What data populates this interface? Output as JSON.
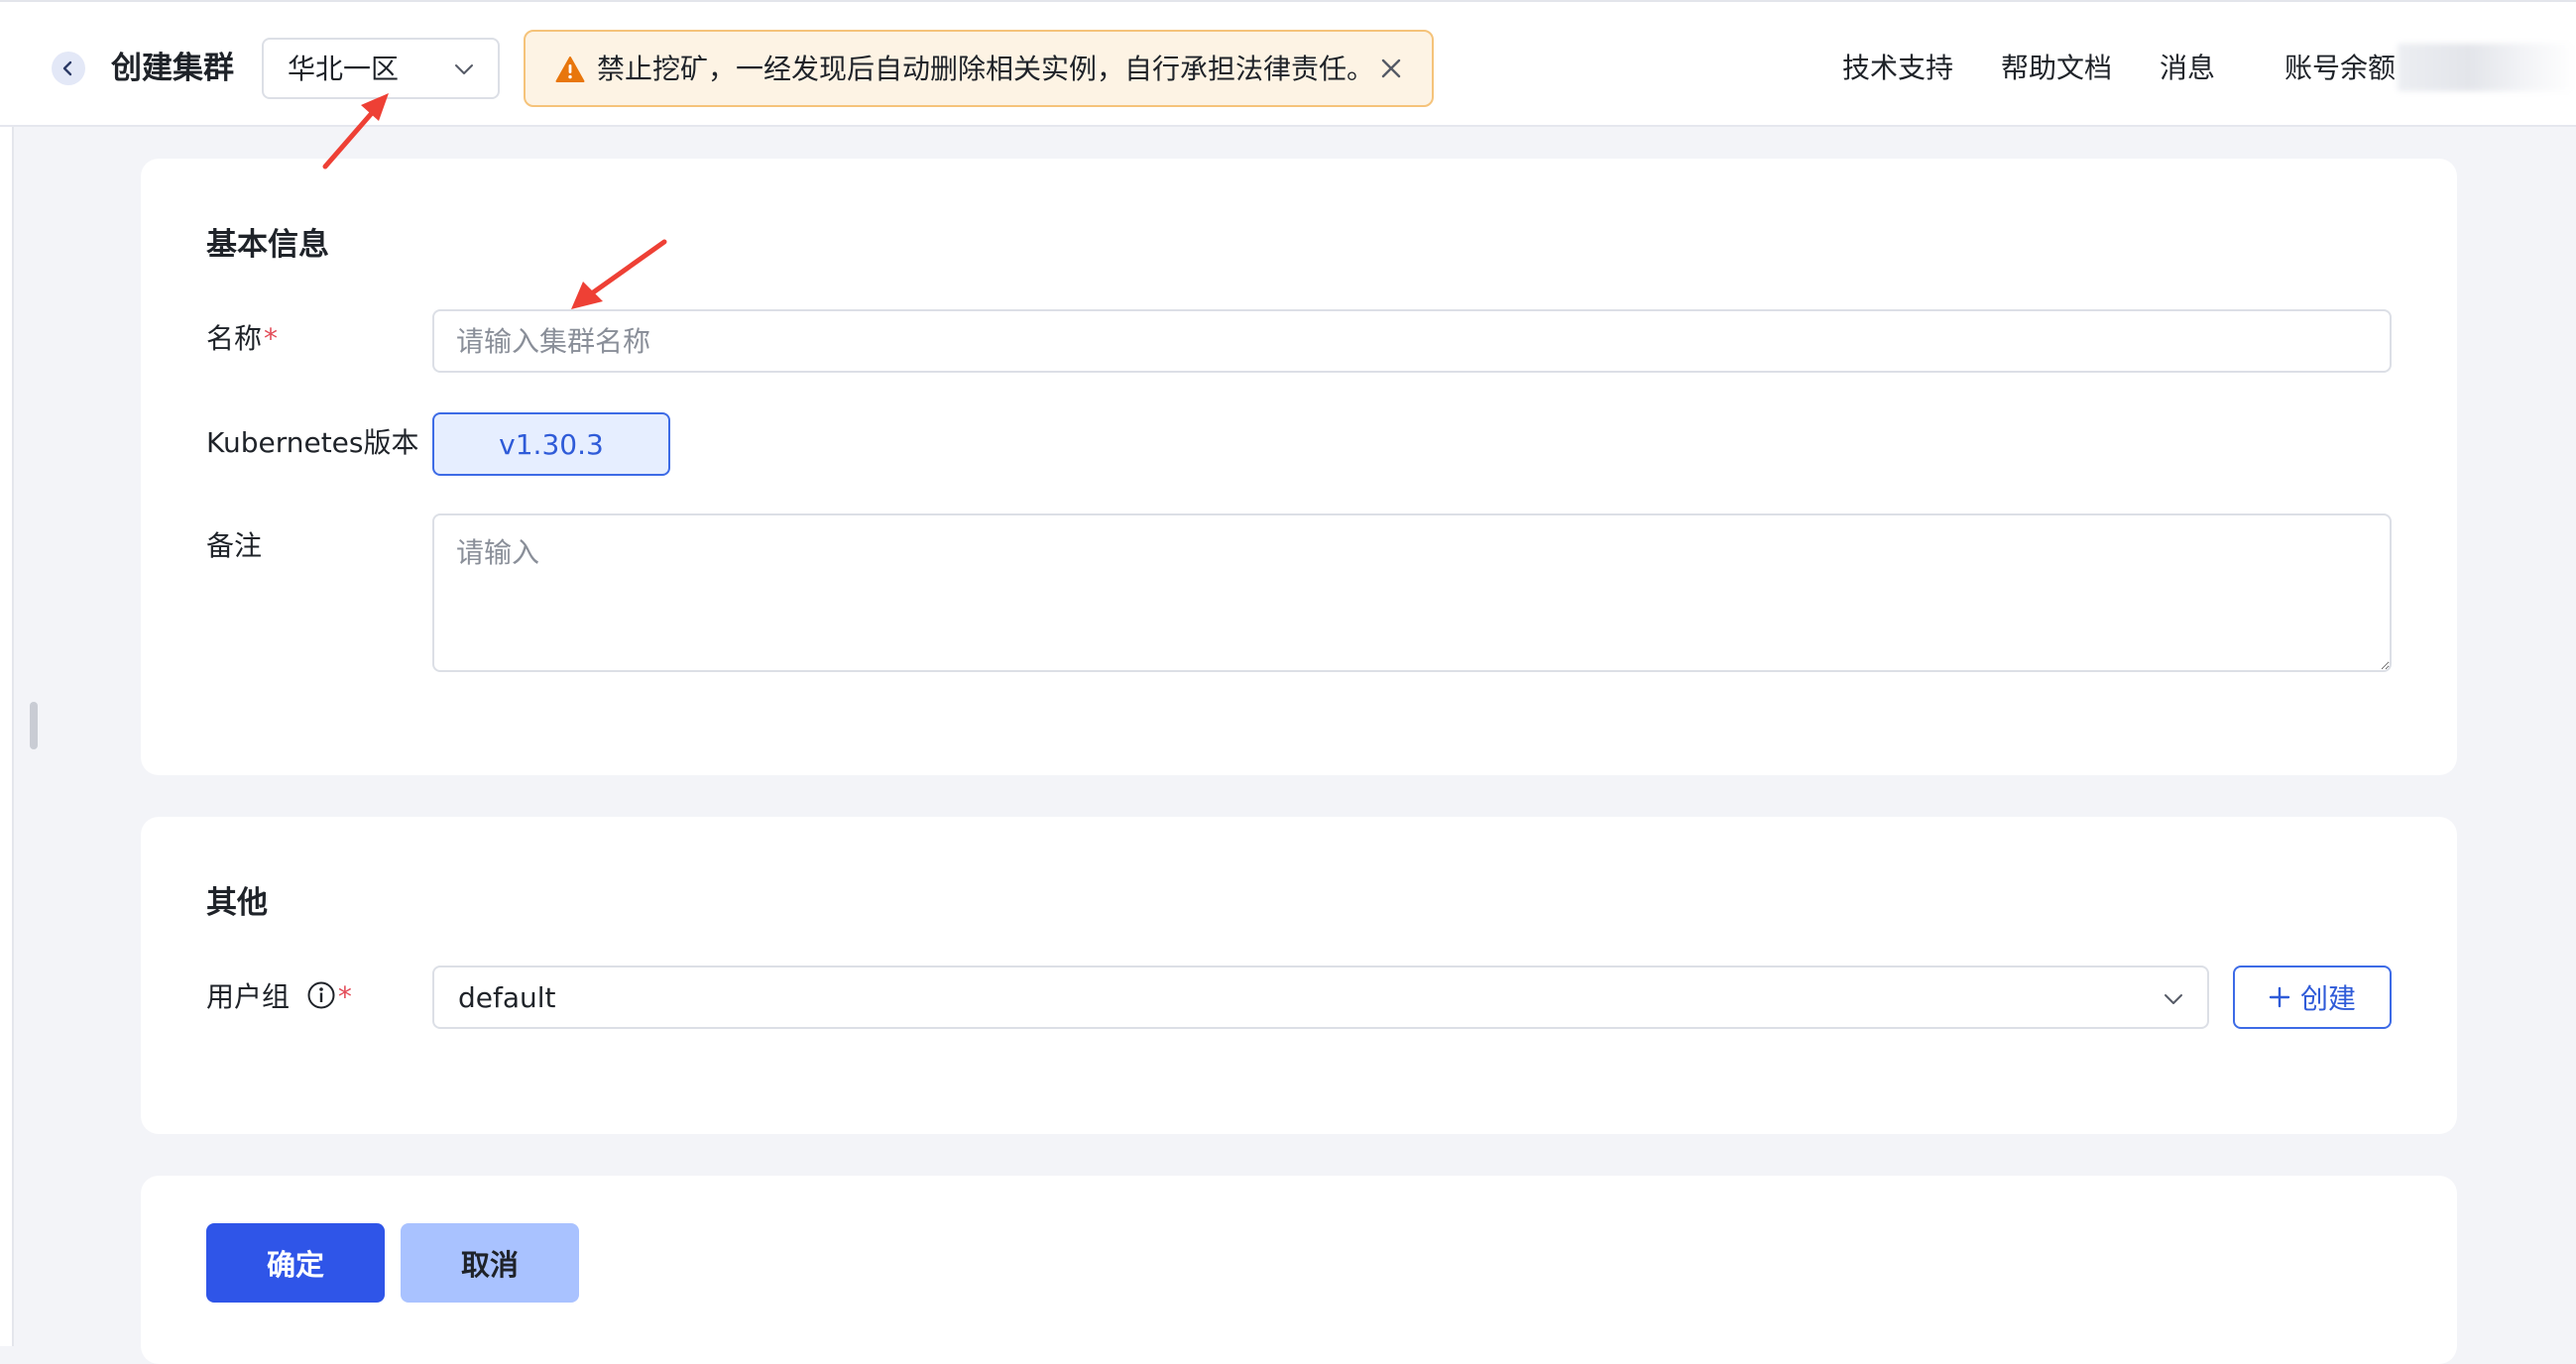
{
  "header": {
    "title": "创建集群",
    "region": {
      "value": "华北一区"
    },
    "notice": {
      "text": "禁止挖矿，一经发现后自动删除相关实例，自行承担法律责任。"
    },
    "nav": {
      "support": "技术支持",
      "docs": "帮助文档",
      "messages": "消息",
      "balance_label": "账号余额"
    }
  },
  "basic": {
    "section_title": "基本信息",
    "name": {
      "label": "名称",
      "required_mark": "*",
      "placeholder": "请输入集群名称",
      "value": ""
    },
    "k8s_version": {
      "label": "Kubernetes版本",
      "selected": "v1.30.3"
    },
    "remark": {
      "label": "备注",
      "placeholder": "请输入",
      "value": ""
    }
  },
  "other": {
    "section_title": "其他",
    "user_group": {
      "label": "用户组",
      "required_mark": "*",
      "value": "default"
    },
    "create_button": "创建"
  },
  "actions": {
    "confirm": "确定",
    "cancel": "取消"
  },
  "colors": {
    "primary": "#2f55e8",
    "primary_light": "#a9c2ff",
    "warning_bg": "#fdf3e4",
    "warning_border": "#f5c37a",
    "warning_icon": "#e8760c",
    "required": "#e34d59",
    "annotation_arrow": "#ee4035"
  },
  "icons": {
    "back": "chevron-left-icon",
    "dropdown": "chevron-down-icon",
    "warning": "warning-triangle-icon",
    "close": "close-icon",
    "info": "info-circle-icon",
    "add": "plus-icon"
  }
}
